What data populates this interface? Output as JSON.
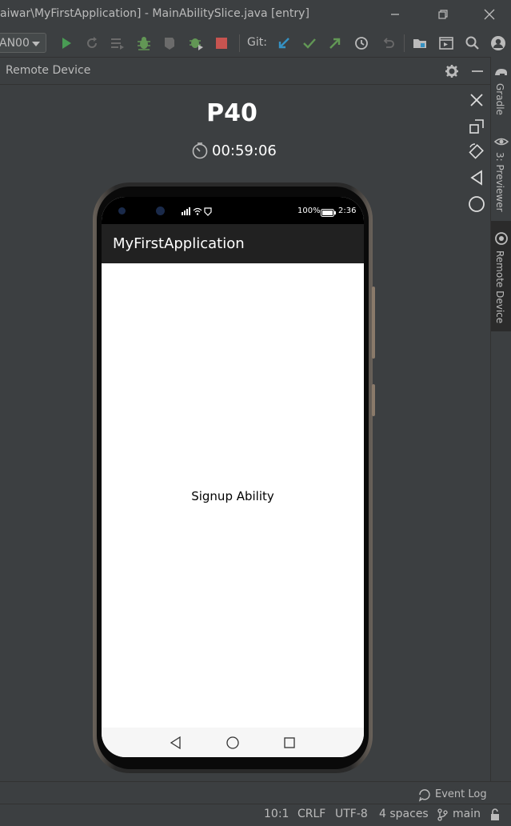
{
  "window": {
    "title": "aiwar\\MyFirstApplication] - MainAbilitySlice.java [entry]"
  },
  "toolbar": {
    "device_select": "AN00",
    "git_label": "Git:"
  },
  "panel": {
    "title": "Remote Device"
  },
  "sidebar": {
    "tabs": [
      {
        "label": "Gradle"
      },
      {
        "label": "3: Previewer"
      },
      {
        "label": "Remote Device"
      }
    ]
  },
  "device": {
    "name": "P40",
    "timer": "00:59:06"
  },
  "phone": {
    "status": {
      "battery": "100%",
      "time": "2:36"
    },
    "app_title": "MyFirstApplication",
    "content_text": "Signup Ability"
  },
  "bottom": {
    "event_log": "Event Log"
  },
  "statusbar": {
    "position": "10:1",
    "line_sep": "CRLF",
    "encoding": "UTF-8",
    "indent": "4 spaces",
    "branch": "main"
  },
  "colors": {
    "run_green": "#499c54",
    "debug_green": "#629755",
    "stop_red": "#c75450",
    "git_blue": "#3592c4"
  }
}
